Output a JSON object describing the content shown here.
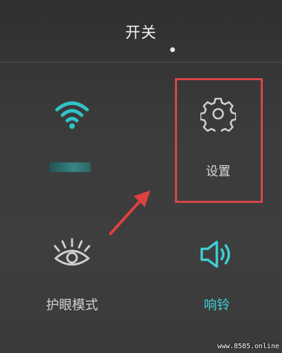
{
  "header": {
    "title": "开关"
  },
  "tiles": {
    "wifi": {
      "icon": "wifi-icon",
      "color": "#2fc3c8"
    },
    "settings": {
      "icon": "gear-icon",
      "label": "设置"
    },
    "eye_comfort": {
      "icon": "eye-icon",
      "label": "护眼模式"
    },
    "sound": {
      "icon": "speaker-icon",
      "label": "响铃",
      "color": "#3ed0d5"
    }
  },
  "annotation": {
    "highlight_color": "#d8474a",
    "arrow_color": "#e0423f"
  },
  "watermark": "www.8585.online"
}
